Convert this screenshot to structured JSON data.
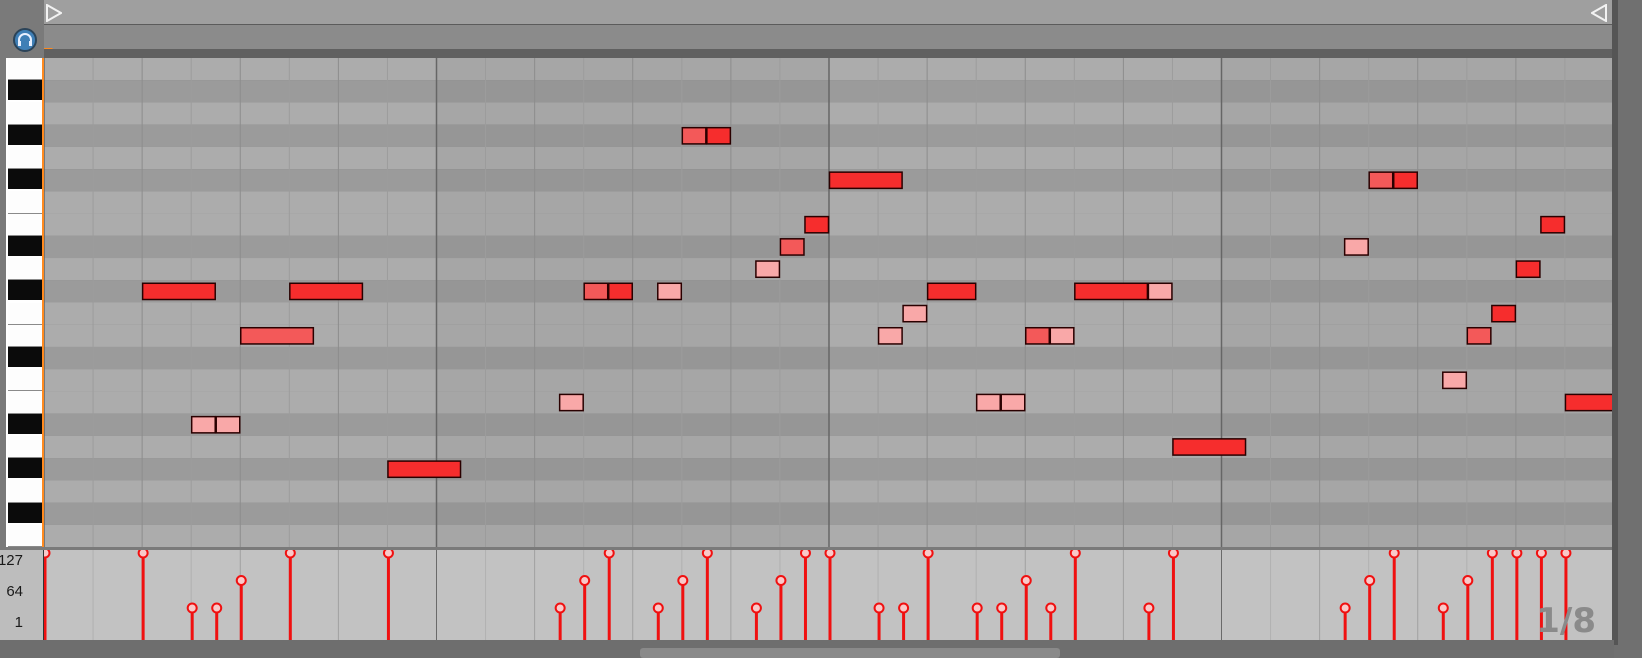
{
  "app": {
    "grid_quantization": "1/8"
  },
  "velocity_scale": {
    "max": "127",
    "mid": "64",
    "min": "1"
  },
  "colors": {
    "note_strong": "#f62d2d",
    "note_light": "#f9a8a8",
    "note_mid": "#f35959",
    "velocity_stem": "#f01010"
  },
  "rows": 22,
  "bars": 4,
  "beats_per_bar": 4,
  "keyboard_pattern": [
    "w",
    "b",
    "w",
    "b",
    "w",
    "b",
    "w",
    "w",
    "b",
    "w",
    "b",
    "w",
    "w",
    "b",
    "w",
    "w",
    "b",
    "w",
    "b",
    "w",
    "b",
    "w"
  ],
  "notes": [
    {
      "row": 10,
      "start": 2.0,
      "len": 0.75,
      "vel": 127
    },
    {
      "row": 16,
      "start": 3.0,
      "len": 0.25,
      "vel": 1
    },
    {
      "row": 16,
      "start": 3.5,
      "len": 0.25,
      "vel": 1
    },
    {
      "row": 12,
      "start": 4.0,
      "len": 0.75,
      "vel": 64
    },
    {
      "row": 10,
      "start": 5.0,
      "len": 0.75,
      "vel": 127
    },
    {
      "row": 18,
      "start": 7.0,
      "len": 0.75,
      "vel": 127
    },
    {
      "row": 15,
      "start": 10.5,
      "len": 0.25,
      "vel": 1
    },
    {
      "row": 10,
      "start": 11.0,
      "len": 0.25,
      "vel": 64
    },
    {
      "row": 10,
      "start": 11.5,
      "len": 0.25,
      "vel": 127
    },
    {
      "row": 10,
      "start": 12.5,
      "len": 0.25,
      "vel": 1
    },
    {
      "row": 3,
      "start": 13.0,
      "len": 0.25,
      "vel": 64
    },
    {
      "row": 3,
      "start": 13.5,
      "len": 0.25,
      "vel": 127
    },
    {
      "row": 9,
      "start": 14.5,
      "len": 0.25,
      "vel": 1
    },
    {
      "row": 8,
      "start": 15.0,
      "len": 0.25,
      "vel": 64
    },
    {
      "row": 7,
      "start": 15.5,
      "len": 0.25,
      "vel": 127
    },
    {
      "row": 5,
      "start": 16.0,
      "len": 0.75,
      "vel": 127
    },
    {
      "row": 12,
      "start": 17.0,
      "len": 0.25,
      "vel": 1
    },
    {
      "row": 11,
      "start": 17.5,
      "len": 0.25,
      "vel": 1
    },
    {
      "row": 10,
      "start": 18.0,
      "len": 0.5,
      "vel": 127
    },
    {
      "row": 15,
      "start": 19.0,
      "len": 0.25,
      "vel": 1
    },
    {
      "row": 15,
      "start": 19.5,
      "len": 0.25,
      "vel": 1
    },
    {
      "row": 12,
      "start": 20.0,
      "len": 0.25,
      "vel": 64
    },
    {
      "row": 12,
      "start": 20.5,
      "len": 0.25,
      "vel": 1
    },
    {
      "row": 10,
      "start": 21.0,
      "len": 0.75,
      "vel": 127
    },
    {
      "row": 10,
      "start": 22.5,
      "len": 0.25,
      "vel": 1
    },
    {
      "row": 17,
      "start": 23.0,
      "len": 0.75,
      "vel": 127
    },
    {
      "row": 8,
      "start": 26.5,
      "len": 0.25,
      "vel": 1
    },
    {
      "row": 5,
      "start": 27.0,
      "len": 0.25,
      "vel": 64
    },
    {
      "row": 5,
      "start": 27.5,
      "len": 0.25,
      "vel": 127
    },
    {
      "row": 14,
      "start": 28.5,
      "len": 0.25,
      "vel": 1
    },
    {
      "row": 12,
      "start": 29.0,
      "len": 0.25,
      "vel": 64
    },
    {
      "row": 11,
      "start": 29.5,
      "len": 0.25,
      "vel": 127
    },
    {
      "row": 9,
      "start": 30.0,
      "len": 0.25,
      "vel": 127
    },
    {
      "row": 7,
      "start": 30.5,
      "len": 0.25,
      "vel": 127
    },
    {
      "row": 15,
      "start": 31.0,
      "len": 0.75,
      "vel": 127
    }
  ],
  "velocity_stems": [
    {
      "pos": 0.0,
      "vel": 127
    },
    {
      "pos": 2.0,
      "vel": 127
    },
    {
      "pos": 3.0,
      "vel": 1
    },
    {
      "pos": 3.5,
      "vel": 1
    },
    {
      "pos": 4.0,
      "vel": 64
    },
    {
      "pos": 5.0,
      "vel": 127
    },
    {
      "pos": 7.0,
      "vel": 127
    },
    {
      "pos": 10.5,
      "vel": 1
    },
    {
      "pos": 11.0,
      "vel": 64
    },
    {
      "pos": 11.5,
      "vel": 127
    },
    {
      "pos": 12.5,
      "vel": 1
    },
    {
      "pos": 13.0,
      "vel": 64
    },
    {
      "pos": 13.5,
      "vel": 127
    },
    {
      "pos": 14.5,
      "vel": 1
    },
    {
      "pos": 15.0,
      "vel": 64
    },
    {
      "pos": 15.5,
      "vel": 127
    },
    {
      "pos": 16.0,
      "vel": 127
    },
    {
      "pos": 17.0,
      "vel": 1
    },
    {
      "pos": 17.5,
      "vel": 1
    },
    {
      "pos": 18.0,
      "vel": 127
    },
    {
      "pos": 19.0,
      "vel": 1
    },
    {
      "pos": 19.5,
      "vel": 1
    },
    {
      "pos": 20.0,
      "vel": 64
    },
    {
      "pos": 20.5,
      "vel": 1
    },
    {
      "pos": 21.0,
      "vel": 127
    },
    {
      "pos": 22.5,
      "vel": 1
    },
    {
      "pos": 23.0,
      "vel": 127
    },
    {
      "pos": 26.5,
      "vel": 1
    },
    {
      "pos": 27.0,
      "vel": 64
    },
    {
      "pos": 27.5,
      "vel": 127
    },
    {
      "pos": 28.5,
      "vel": 1
    },
    {
      "pos": 29.0,
      "vel": 64
    },
    {
      "pos": 29.5,
      "vel": 127
    },
    {
      "pos": 30.0,
      "vel": 127
    },
    {
      "pos": 30.5,
      "vel": 127
    },
    {
      "pos": 31.0,
      "vel": 127
    }
  ]
}
